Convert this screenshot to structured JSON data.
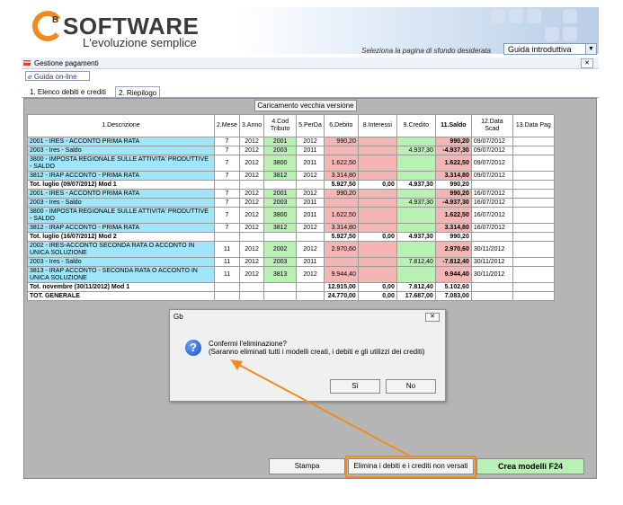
{
  "header": {
    "logo_prefix": "G",
    "logo_sup": "B",
    "logo_name": "SOFTWARE",
    "tagline": "L'evoluzione semplice",
    "bg_label": "Seleziona la pagina di sfondo desiderata",
    "bg_value": "Guida introduttiva"
  },
  "panel": {
    "title": "Gestione pagamenti",
    "guida": "Guida on-line",
    "tabs": [
      "1. Elenco debiti e crediti",
      "2. Riepilogo"
    ],
    "carica_button": "Caricamento vecchia versione"
  },
  "table": {
    "columns": [
      "1.Descrizione",
      "2.Mese",
      "3.Anno",
      "4.Cod Tributo",
      "5.PerDa",
      "6.Debito",
      "8.Interessi",
      "9.Credito",
      "11.Saldo",
      "12.Data Scad",
      "13.Data Pag"
    ],
    "rows": [
      {
        "type": "item",
        "desc": "2001 - IRES - ACCONTO PRIMA RATA",
        "mese": "7",
        "anno": "2012",
        "cod": "2001",
        "perda": "2012",
        "debito": "990,20",
        "interessi": "",
        "credito": "",
        "saldo": "990,20",
        "scad": "09/07/2012",
        "pag": ""
      },
      {
        "type": "item",
        "desc": "2003 - Ires - Saldo",
        "mese": "7",
        "anno": "2012",
        "cod": "2003",
        "perda": "2011",
        "debito": "",
        "interessi": "",
        "credito": "4.937,30",
        "saldo": "-4.937,30",
        "scad": "09/07/2012",
        "pag": ""
      },
      {
        "type": "item2",
        "desc": "3800 - IMPOSTA REGIONALE SULLE ATTIVITA' PRODUTTIVE - SALDO",
        "mese": "7",
        "anno": "2012",
        "cod": "3800",
        "perda": "2011",
        "debito": "1.622,50",
        "interessi": "",
        "credito": "",
        "saldo": "1.622,50",
        "scad": "09/07/2012",
        "pag": ""
      },
      {
        "type": "item",
        "desc": "3812 - IRAP ACCONTO - PRIMA RATA",
        "mese": "7",
        "anno": "2012",
        "cod": "3812",
        "perda": "2012",
        "debito": "3.314,80",
        "interessi": "",
        "credito": "",
        "saldo": "3.314,80",
        "scad": "09/07/2012",
        "pag": ""
      },
      {
        "type": "total",
        "desc": "Tot. luglio (09/07/2012) Mod 1",
        "mese": "",
        "anno": "",
        "cod": "",
        "perda": "",
        "debito": "5.927,50",
        "interessi": "0,00",
        "credito": "4.937,30",
        "saldo": "990,20",
        "scad": "",
        "pag": ""
      },
      {
        "type": "item",
        "desc": "2001 - IRES - ACCONTO PRIMA RATA",
        "mese": "7",
        "anno": "2012",
        "cod": "2001",
        "perda": "2012",
        "debito": "990,20",
        "interessi": "",
        "credito": "",
        "saldo": "990,20",
        "scad": "16/07/2012",
        "pag": ""
      },
      {
        "type": "item",
        "desc": "2003 - Ires - Saldo",
        "mese": "7",
        "anno": "2012",
        "cod": "2003",
        "perda": "2011",
        "debito": "",
        "interessi": "",
        "credito": "4.937,30",
        "saldo": "-4.937,30",
        "scad": "16/07/2012",
        "pag": ""
      },
      {
        "type": "item2",
        "desc": "3800 - IMPOSTA REGIONALE SULLE ATTIVITA' PRODUTTIVE - SALDO",
        "mese": "7",
        "anno": "2012",
        "cod": "3800",
        "perda": "2011",
        "debito": "1.622,50",
        "interessi": "",
        "credito": "",
        "saldo": "1.622,50",
        "scad": "16/07/2012",
        "pag": ""
      },
      {
        "type": "item",
        "desc": "3812 - IRAP ACCONTO - PRIMA RATA",
        "mese": "7",
        "anno": "2012",
        "cod": "3812",
        "perda": "2012",
        "debito": "3.314,80",
        "interessi": "",
        "credito": "",
        "saldo": "3.314,80",
        "scad": "16/07/2012",
        "pag": ""
      },
      {
        "type": "total",
        "desc": "Tot. luglio (16/07/2012) Mod 2",
        "mese": "",
        "anno": "",
        "cod": "",
        "perda": "",
        "debito": "5.927,50",
        "interessi": "0,00",
        "credito": "4.937,30",
        "saldo": "990,20",
        "scad": "",
        "pag": ""
      },
      {
        "type": "item2",
        "desc": "2002 - IRES-ACCONTO SECONDA RATA O ACCONTO IN UNICA SOLUZIONE",
        "mese": "11",
        "anno": "2012",
        "cod": "2002",
        "perda": "2012",
        "debito": "2.970,60",
        "interessi": "",
        "credito": "",
        "saldo": "2.970,60",
        "scad": "30/11/2012",
        "pag": ""
      },
      {
        "type": "item",
        "desc": "2003 - Ires - Saldo",
        "mese": "11",
        "anno": "2012",
        "cod": "2003",
        "perda": "2011",
        "debito": "",
        "interessi": "",
        "credito": "7.812,40",
        "saldo": "-7.812,40",
        "scad": "30/11/2012",
        "pag": ""
      },
      {
        "type": "item2",
        "desc": "3813 - IRAP ACCONTO - SECONDA RATA O ACCONTO IN UNICA SOLUZIONE",
        "mese": "11",
        "anno": "2012",
        "cod": "3813",
        "perda": "2012",
        "debito": "9.944,40",
        "interessi": "",
        "credito": "",
        "saldo": "9.944,40",
        "scad": "30/11/2012",
        "pag": ""
      },
      {
        "type": "total",
        "desc": "Tot. novembre (30/11/2012) Mod 1",
        "mese": "",
        "anno": "",
        "cod": "",
        "perda": "",
        "debito": "12.915,00",
        "interessi": "0,00",
        "credito": "7.812,40",
        "saldo": "5.102,60",
        "scad": "",
        "pag": ""
      },
      {
        "type": "total",
        "desc": "TOT. GENERALE",
        "mese": "",
        "anno": "",
        "cod": "",
        "perda": "",
        "debito": "24.770,00",
        "interessi": "0,00",
        "credito": "17.687,00",
        "saldo": "7.083,00",
        "scad": "",
        "pag": ""
      }
    ]
  },
  "dialog": {
    "title": "Gb",
    "line1": "Confermi l'eliminazione?",
    "line2": "(Saranno eliminati tutti i modelli creati, i debiti e gli utilizzi dei crediti)",
    "yes": "Sì",
    "no": "No"
  },
  "footer": {
    "stampa": "Stampa",
    "elimina": "Elimina i debiti e i crediti non versati",
    "crea": "Crea modelli F24"
  },
  "colors": {
    "highlight": "#f08c1e",
    "desc_bg": "#9fe6fb",
    "code_bg": "#b9f0b4",
    "debit_bg": "#f5b5b5"
  }
}
